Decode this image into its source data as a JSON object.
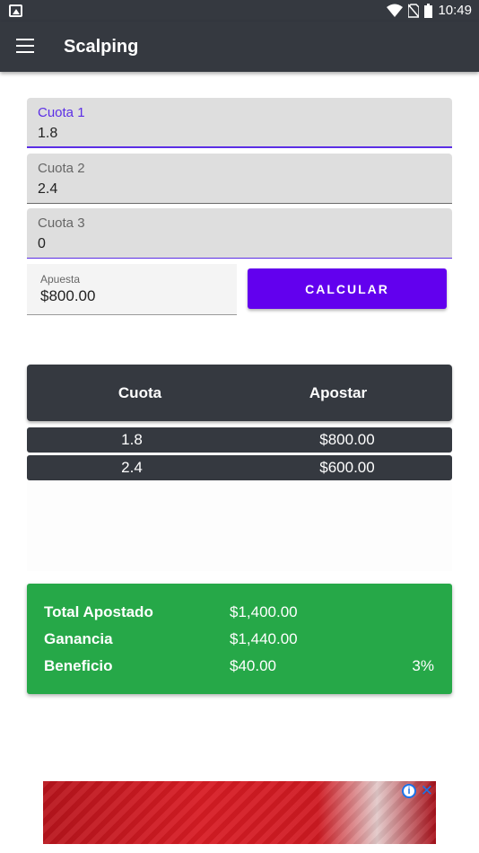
{
  "status_bar": {
    "time": "10:49",
    "icons": [
      "image-icon",
      "wifi-icon",
      "no-sim-icon",
      "battery-icon"
    ]
  },
  "app_bar": {
    "title": "Scalping",
    "menu_icon": "menu-icon"
  },
  "inputs": [
    {
      "label": "Cuota 1",
      "value": "1.8"
    },
    {
      "label": "Cuota 2",
      "value": "2.4"
    },
    {
      "label": "Cuota 3",
      "value": "0"
    }
  ],
  "apuesta": {
    "label": "Apuesta",
    "value": "$800.00"
  },
  "calc_button": {
    "label": "CALCULAR"
  },
  "table": {
    "headers": [
      "Cuota",
      "Apostar"
    ],
    "rows": [
      {
        "cuota": "1.8",
        "apostar": "$800.00"
      },
      {
        "cuota": "2.4",
        "apostar": "$600.00"
      }
    ]
  },
  "summary": {
    "total_label": "Total Apostado",
    "total_value": "$1,400.00",
    "ganancia_label": "Ganancia",
    "ganancia_value": "$1,440.00",
    "beneficio_label": "Beneficio",
    "beneficio_value": "$40.00",
    "beneficio_pct": "3%"
  },
  "ad": {
    "info_icon": "ad-info-icon",
    "close_icon": "ad-close-icon"
  },
  "colors": {
    "appbar": "#353940",
    "accent": "#6200ee",
    "summary": "#26a848",
    "focus": "#5b2ee6"
  }
}
